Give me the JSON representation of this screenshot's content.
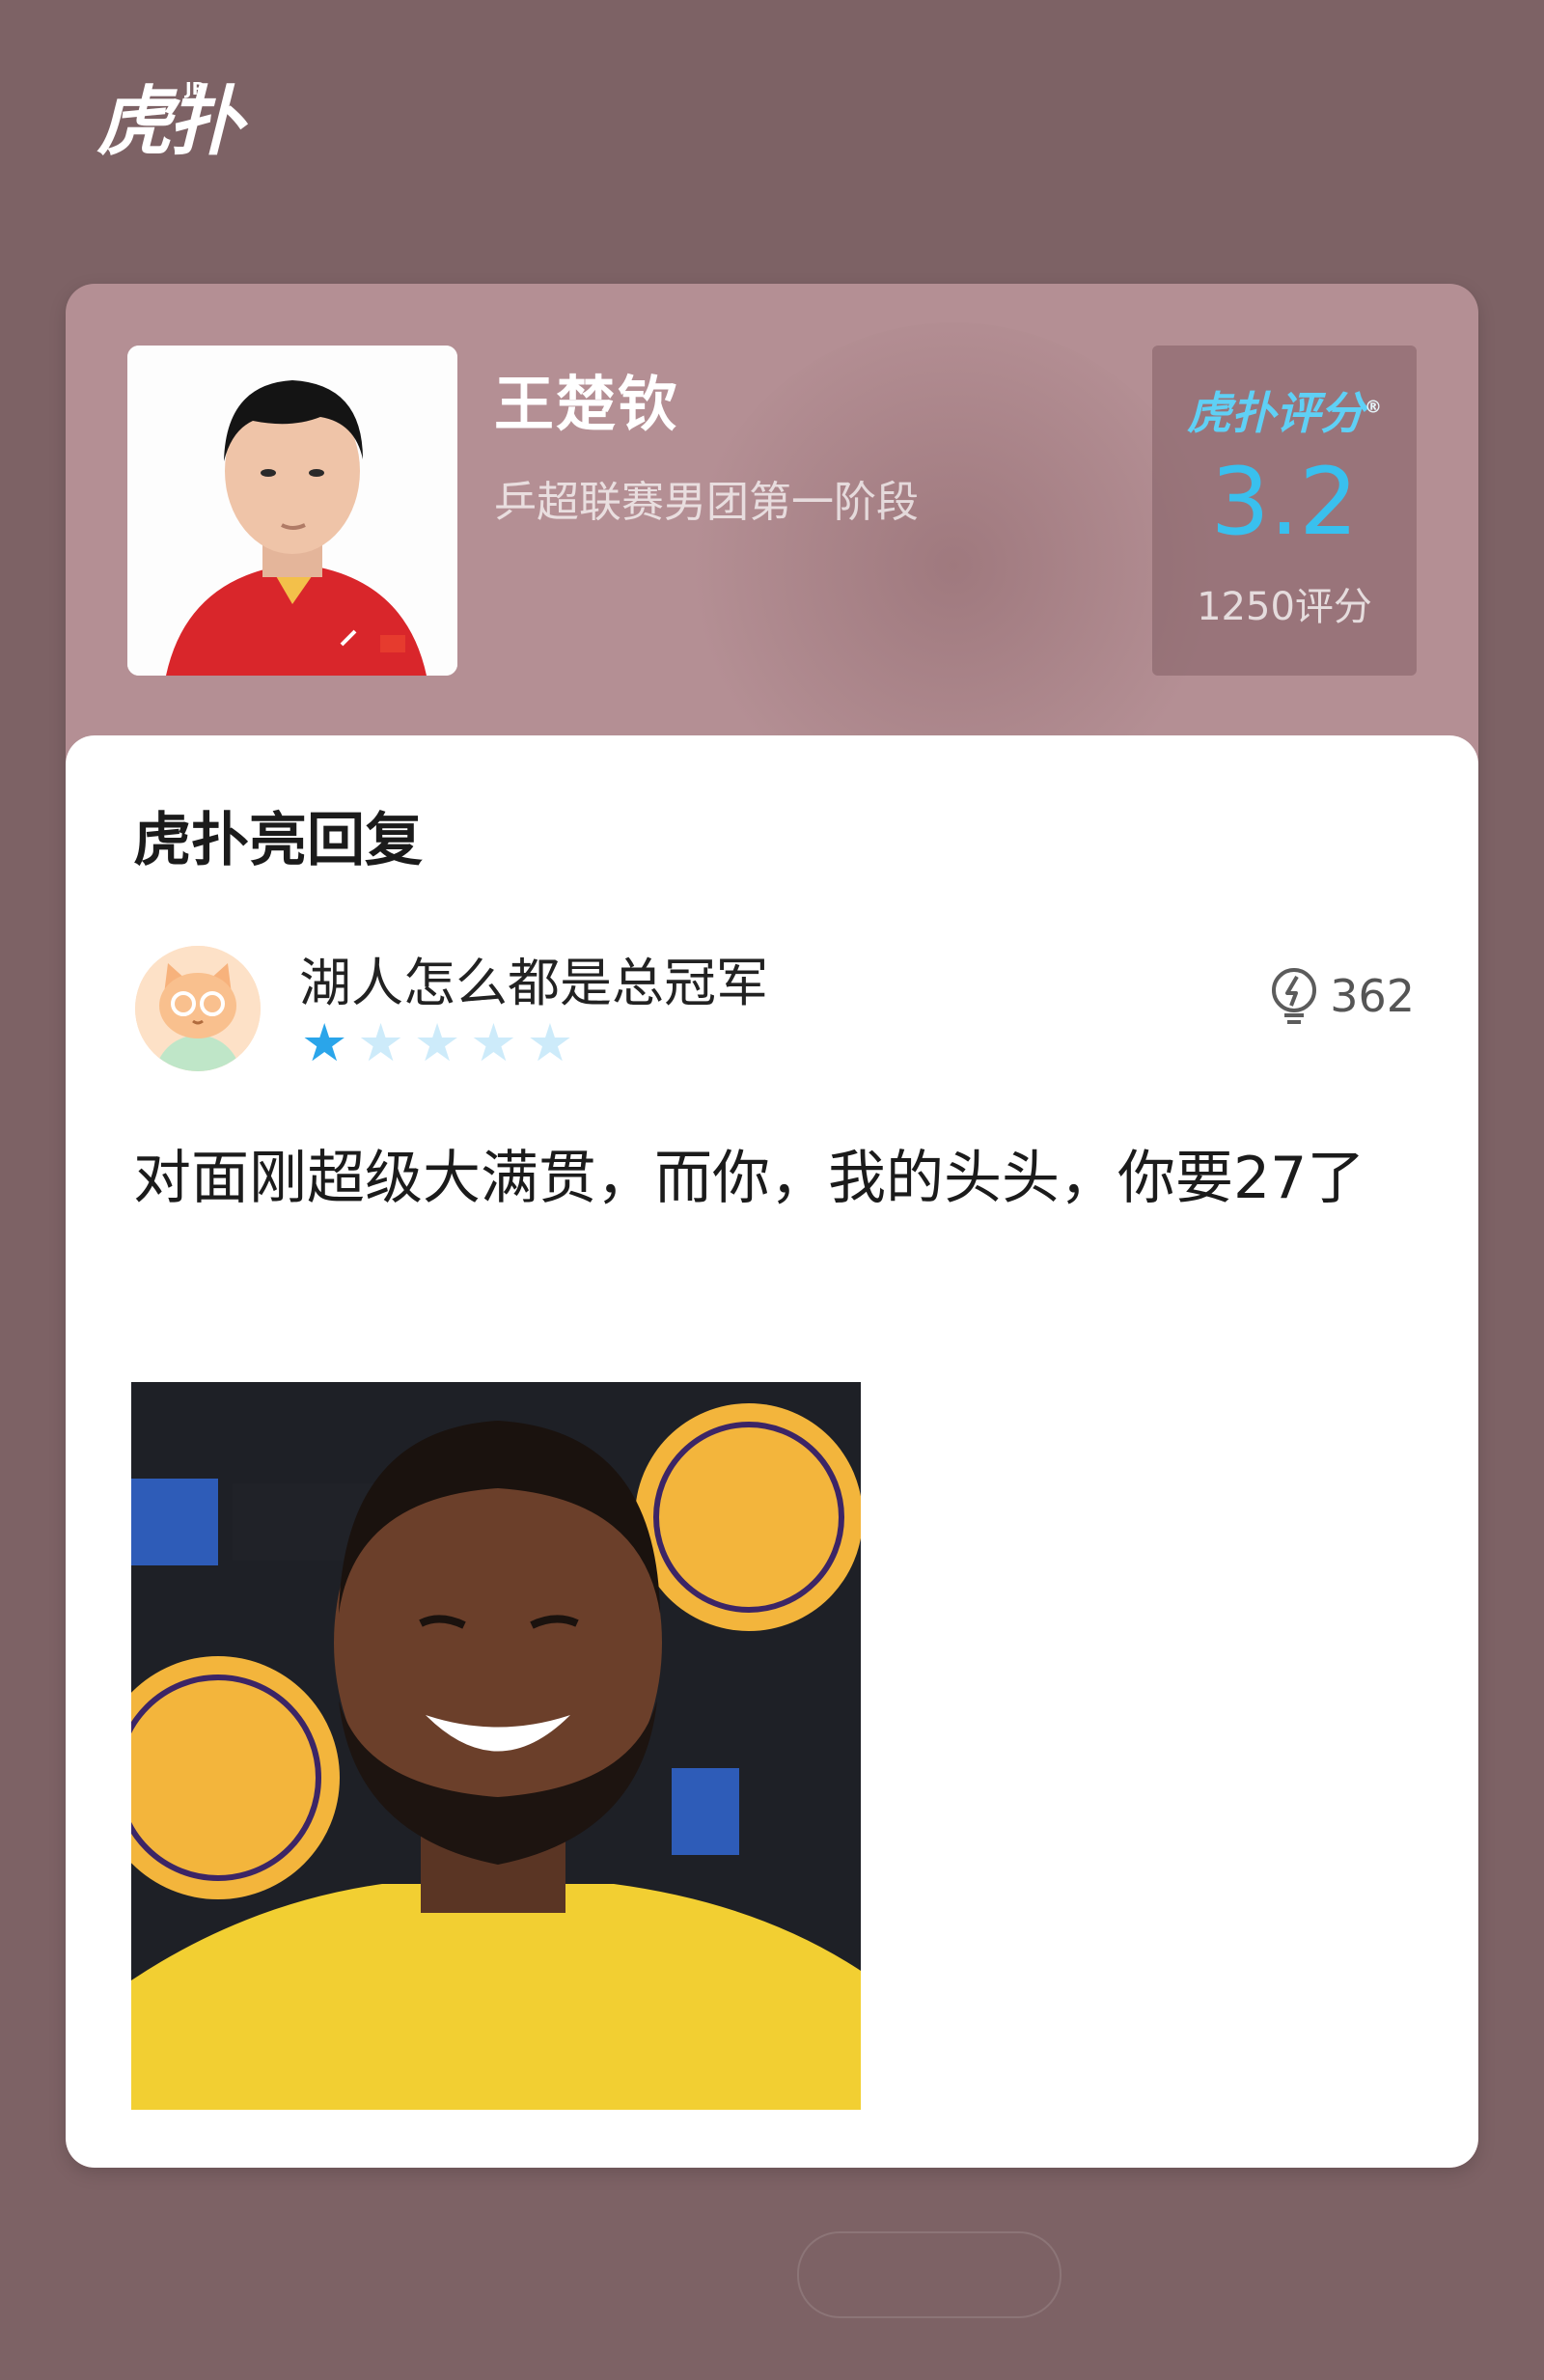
{
  "brand": {
    "logo_text": "虎扑",
    "logo_sup": "JR"
  },
  "player": {
    "name": "王楚钦",
    "event": "乒超联赛男团第一阶段",
    "photo": "player-portrait-photo"
  },
  "score": {
    "brand_label": "虎扑评分",
    "brand_mark": "®",
    "value": "3.2",
    "count_label": "1250评分",
    "accent_color": "#39c0ee"
  },
  "reply": {
    "section_title": "虎扑亮回复",
    "username": "湖人怎么都是总冠军",
    "rating_stars": 1,
    "max_stars": 5,
    "likes": "362",
    "text": "对面刚超级大满贯，而你，我的头头，你要27了",
    "image": "laughing-player-meme-photo"
  },
  "footer": {
    "button_text": ""
  },
  "colors": {
    "page_bg": "#7d6265",
    "card_bg": "#b48f94",
    "star_on": "#2aa5ea",
    "star_off": "#cdebfa"
  }
}
